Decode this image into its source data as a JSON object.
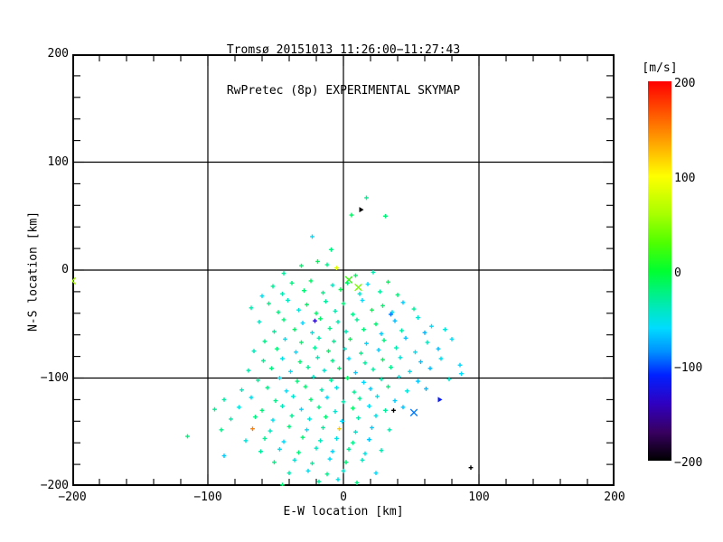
{
  "title": {
    "line1": "Tromsø 20151013 11:26:00−11:27:43",
    "line2": "RwPretec (8p) EXPERIMENTAL SKYMAP"
  },
  "chart_data": {
    "type": "scatter",
    "title": "Tromsø 20151013 11:26:00−11:27:43 / RwPretec (8p) EXPERIMENTAL SKYMAP",
    "xlabel": "E-W location [km]",
    "ylabel": "N-S location [km]",
    "xlim": [
      -200,
      200
    ],
    "ylim": [
      -200,
      200
    ],
    "grid": true,
    "grid_values": [
      -100,
      0,
      100
    ],
    "major_tick_step": 100,
    "minor_tick_step": 20,
    "x_ticks": [
      -200,
      -100,
      0,
      100,
      200
    ],
    "x_tick_labels": [
      "−200",
      "−100",
      "0",
      "100",
      "200"
    ],
    "y_ticks": [
      -200,
      -100,
      0,
      100,
      200
    ],
    "y_tick_labels": [
      "−200",
      "−100",
      "0",
      "100",
      "200"
    ],
    "colorbar": {
      "label": "[m/s]",
      "min": -200,
      "max": 200,
      "ticks": [
        200,
        100,
        0,
        -100,
        -200
      ],
      "tick_labels": [
        "200",
        "100",
        "0",
        "−100",
        "−200"
      ]
    },
    "color_stops": [
      [
        200,
        "#ff0000"
      ],
      [
        150,
        "#ff7f00"
      ],
      [
        100,
        "#ffff00"
      ],
      [
        60,
        "#a8ff00"
      ],
      [
        30,
        "#50ff00"
      ],
      [
        0,
        "#00ff30"
      ],
      [
        -40,
        "#00e8c0"
      ],
      [
        -60,
        "#00dcff"
      ],
      [
        -85,
        "#0090ff"
      ],
      [
        -110,
        "#0020ff"
      ],
      [
        -140,
        "#3000c0"
      ],
      [
        -170,
        "#380060"
      ],
      [
        -200,
        "#000000"
      ]
    ],
    "marker_legend": {
      "plus": "radar echo",
      "x": "large cross echo",
      "tri": "triangle echo"
    },
    "points": [
      [
        17,
        67,
        -28
      ],
      [
        31,
        50,
        -20
      ],
      [
        6,
        51,
        -15
      ],
      [
        -23,
        31,
        -58
      ],
      [
        -9,
        19,
        -22
      ],
      [
        13,
        56,
        -200,
        "tri"
      ],
      [
        -31,
        4,
        -18
      ],
      [
        -19,
        8,
        -12
      ],
      [
        -12,
        5,
        -25
      ],
      [
        -44,
        -3,
        -30
      ],
      [
        22,
        -2,
        -35
      ],
      [
        9,
        -5,
        -15
      ],
      [
        -5,
        2,
        85
      ],
      [
        4,
        -9,
        20,
        "x"
      ],
      [
        11,
        -16,
        45,
        "x"
      ],
      [
        -200,
        -10,
        60,
        "x"
      ],
      [
        -38,
        -12,
        -22
      ],
      [
        -24,
        -10,
        -15
      ],
      [
        -8,
        -14,
        -40
      ],
      [
        3,
        -12,
        -18
      ],
      [
        18,
        -13,
        -60
      ],
      [
        -52,
        -15,
        -28
      ],
      [
        33,
        -11,
        -12
      ],
      [
        -45,
        -22,
        -35
      ],
      [
        -29,
        -19,
        -18
      ],
      [
        -15,
        -21,
        -25
      ],
      [
        -2,
        -18,
        -10
      ],
      [
        12,
        -22,
        -45
      ],
      [
        27,
        -20,
        -30
      ],
      [
        -60,
        -24,
        -55
      ],
      [
        40,
        -23,
        -20
      ],
      [
        -55,
        -31,
        -25
      ],
      [
        -41,
        -28,
        -40
      ],
      [
        -27,
        -32,
        -15
      ],
      [
        -13,
        -29,
        -30
      ],
      [
        0,
        -31,
        -20
      ],
      [
        14,
        -28,
        -60
      ],
      [
        29,
        -33,
        -18
      ],
      [
        44,
        -30,
        -65
      ],
      [
        -68,
        -35,
        -35
      ],
      [
        -48,
        -39,
        -22
      ],
      [
        -33,
        -37,
        -48
      ],
      [
        -20,
        -40,
        -15
      ],
      [
        -6,
        -38,
        -35
      ],
      [
        7,
        -41,
        -25
      ],
      [
        21,
        -37,
        -10
      ],
      [
        36,
        -39,
        -55
      ],
      [
        52,
        -36,
        -30
      ],
      [
        -21,
        -47,
        -135
      ],
      [
        35,
        -41,
        -90
      ],
      [
        -62,
        -48,
        -42
      ],
      [
        -44,
        -46,
        -20
      ],
      [
        -30,
        -49,
        -62
      ],
      [
        -17,
        -45,
        -15
      ],
      [
        -4,
        -48,
        -35
      ],
      [
        10,
        -46,
        -28
      ],
      [
        24,
        -50,
        -18
      ],
      [
        38,
        -47,
        -70
      ],
      [
        55,
        -44,
        -45
      ],
      [
        65,
        -52,
        -58
      ],
      [
        -51,
        -57,
        -30
      ],
      [
        -36,
        -55,
        -15
      ],
      [
        -23,
        -58,
        -50
      ],
      [
        -10,
        -54,
        -25
      ],
      [
        2,
        -57,
        -38
      ],
      [
        15,
        -55,
        -20
      ],
      [
        28,
        -59,
        -65
      ],
      [
        43,
        -56,
        -32
      ],
      [
        60,
        -58,
        -72
      ],
      [
        75,
        -55,
        -48
      ],
      [
        -58,
        -66,
        -25
      ],
      [
        -43,
        -64,
        -55
      ],
      [
        -31,
        -67,
        -18
      ],
      [
        -18,
        -63,
        -35
      ],
      [
        -7,
        -66,
        -28
      ],
      [
        5,
        -64,
        -12
      ],
      [
        17,
        -68,
        -60
      ],
      [
        30,
        -65,
        -22
      ],
      [
        46,
        -63,
        -68
      ],
      [
        62,
        -67,
        -40
      ],
      [
        80,
        -64,
        -58
      ],
      [
        -66,
        -75,
        -38
      ],
      [
        -49,
        -73,
        -20
      ],
      [
        -35,
        -76,
        -60
      ],
      [
        -21,
        -72,
        -28
      ],
      [
        -11,
        -75,
        -15
      ],
      [
        1,
        -73,
        -45
      ],
      [
        13,
        -77,
        -25
      ],
      [
        26,
        -74,
        -65
      ],
      [
        39,
        -72,
        -35
      ],
      [
        53,
        -76,
        -55
      ],
      [
        70,
        -73,
        -70
      ],
      [
        86,
        -88,
        -62
      ],
      [
        -59,
        -84,
        -28
      ],
      [
        -45,
        -82,
        -52
      ],
      [
        -32,
        -85,
        -18
      ],
      [
        -19,
        -81,
        -38
      ],
      [
        -8,
        -84,
        -25
      ],
      [
        4,
        -82,
        -60
      ],
      [
        16,
        -86,
        -30
      ],
      [
        29,
        -83,
        -15
      ],
      [
        42,
        -81,
        -48
      ],
      [
        57,
        -85,
        -68
      ],
      [
        72,
        -82,
        -55
      ],
      [
        -70,
        -93,
        -35
      ],
      [
        -53,
        -91,
        -22
      ],
      [
        -39,
        -94,
        -58
      ],
      [
        -26,
        -90,
        -28
      ],
      [
        -14,
        -93,
        -45
      ],
      [
        -3,
        -91,
        -18
      ],
      [
        9,
        -95,
        -65
      ],
      [
        22,
        -92,
        -32
      ],
      [
        35,
        -90,
        -25
      ],
      [
        49,
        -94,
        -55
      ],
      [
        64,
        -91,
        -70
      ],
      [
        87,
        -96,
        -60
      ],
      [
        -63,
        -102,
        -30
      ],
      [
        -47,
        -100,
        -55
      ],
      [
        -34,
        -103,
        -20
      ],
      [
        -22,
        -99,
        -42
      ],
      [
        -9,
        -102,
        -28
      ],
      [
        3,
        -100,
        -15
      ],
      [
        15,
        -104,
        -62
      ],
      [
        28,
        -101,
        -35
      ],
      [
        41,
        -99,
        -50
      ],
      [
        55,
        -103,
        -68
      ],
      [
        78,
        -101,
        -45
      ],
      [
        -75,
        -111,
        -40
      ],
      [
        -56,
        -109,
        -25
      ],
      [
        -42,
        -112,
        -58
      ],
      [
        -28,
        -108,
        -18
      ],
      [
        -16,
        -111,
        -35
      ],
      [
        -5,
        -109,
        -52
      ],
      [
        8,
        -113,
        -28
      ],
      [
        20,
        -110,
        -65
      ],
      [
        33,
        -108,
        -22
      ],
      [
        47,
        -112,
        -48
      ],
      [
        61,
        -110,
        -70
      ],
      [
        -88,
        -120,
        -32
      ],
      [
        -68,
        -118,
        -55
      ],
      [
        -50,
        -121,
        -25
      ],
      [
        -37,
        -117,
        -45
      ],
      [
        -24,
        -120,
        -18
      ],
      [
        -12,
        -118,
        -60
      ],
      [
        0,
        -122,
        -35
      ],
      [
        12,
        -119,
        -28
      ],
      [
        25,
        -117,
        -52
      ],
      [
        38,
        -121,
        -65
      ],
      [
        71,
        -120,
        -115,
        "tri"
      ],
      [
        -95,
        -129,
        -28
      ],
      [
        -77,
        -127,
        -50
      ],
      [
        -60,
        -130,
        -20
      ],
      [
        -45,
        -126,
        -38
      ],
      [
        -31,
        -129,
        -62
      ],
      [
        -18,
        -127,
        -25
      ],
      [
        -6,
        -131,
        -45
      ],
      [
        7,
        -128,
        -15
      ],
      [
        19,
        -126,
        -58
      ],
      [
        31,
        -130,
        -30
      ],
      [
        44,
        -127,
        -68
      ],
      [
        37,
        -130,
        -200
      ],
      [
        52,
        -132,
        -90,
        "x"
      ],
      [
        -83,
        -138,
        -35
      ],
      [
        -65,
        -136,
        -22
      ],
      [
        -52,
        -139,
        -55
      ],
      [
        -38,
        -135,
        -28
      ],
      [
        -25,
        -138,
        -48
      ],
      [
        -13,
        -136,
        -18
      ],
      [
        -1,
        -140,
        -60
      ],
      [
        11,
        -137,
        -32
      ],
      [
        24,
        -135,
        -52
      ],
      [
        -90,
        -148,
        -25
      ],
      [
        -67,
        -147,
        150
      ],
      [
        -54,
        -149,
        -40
      ],
      [
        -40,
        -145,
        -20
      ],
      [
        -27,
        -148,
        -58
      ],
      [
        -15,
        -146,
        -30
      ],
      [
        -3,
        -147,
        120
      ],
      [
        9,
        -150,
        -45
      ],
      [
        21,
        -146,
        -65
      ],
      [
        34,
        -148,
        -35
      ],
      [
        -115,
        -154,
        -22
      ],
      [
        -72,
        -158,
        -48
      ],
      [
        -58,
        -156,
        -28
      ],
      [
        -44,
        -159,
        -60
      ],
      [
        -30,
        -155,
        -18
      ],
      [
        -17,
        -158,
        -38
      ],
      [
        -5,
        -156,
        -52
      ],
      [
        7,
        -160,
        -25
      ],
      [
        19,
        -157,
        -68
      ],
      [
        -61,
        -168,
        -30
      ],
      [
        -47,
        -166,
        -55
      ],
      [
        -33,
        -169,
        -20
      ],
      [
        -20,
        -165,
        -42
      ],
      [
        -8,
        -168,
        -62
      ],
      [
        4,
        -166,
        -28
      ],
      [
        16,
        -170,
        -50
      ],
      [
        28,
        -167,
        -35
      ],
      [
        -88,
        -172,
        -65
      ],
      [
        -51,
        -178,
        -25
      ],
      [
        -36,
        -176,
        -48
      ],
      [
        -23,
        -179,
        -30
      ],
      [
        -10,
        -175,
        -58
      ],
      [
        2,
        -178,
        -20
      ],
      [
        14,
        -176,
        -40
      ],
      [
        -40,
        -188,
        -35
      ],
      [
        -26,
        -186,
        -55
      ],
      [
        -12,
        -189,
        -25
      ],
      [
        0,
        -186,
        -45
      ],
      [
        24,
        -188,
        -60
      ],
      [
        94,
        -183,
        -200
      ],
      [
        -18,
        -196,
        -30
      ],
      [
        -4,
        -194,
        -52
      ],
      [
        10,
        -197,
        -22
      ],
      [
        -45,
        -199,
        -20
      ]
    ]
  }
}
